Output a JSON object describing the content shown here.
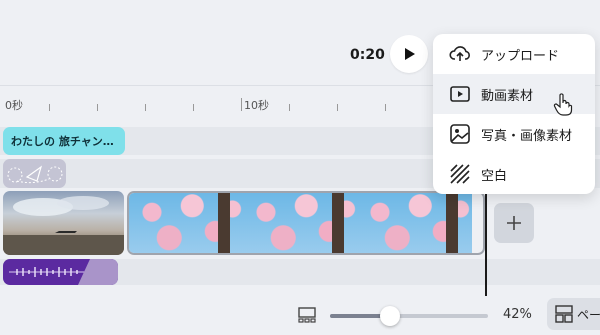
{
  "player": {
    "time": "0:20"
  },
  "ruler": {
    "labels": [
      "0秒",
      "10秒"
    ]
  },
  "tracks": {
    "title_clip": "わたしの 旅チャン…"
  },
  "add_menu": {
    "items": [
      {
        "label": "アップロード",
        "icon": "cloud-upload-icon"
      },
      {
        "label": "動画素材",
        "icon": "video-play-icon"
      },
      {
        "label": "写真・画像素材",
        "icon": "image-icon"
      },
      {
        "label": "空白",
        "icon": "blank-hatch-icon"
      }
    ],
    "hovered_index": 1
  },
  "zoom": {
    "value": "42%",
    "level": 0.38
  },
  "page_button": {
    "label": "ペー"
  },
  "colors": {
    "title_clip": "#7fe0ea",
    "audio_clip": "#5b2aa0",
    "sticker_clip": "#c4c4d4"
  }
}
